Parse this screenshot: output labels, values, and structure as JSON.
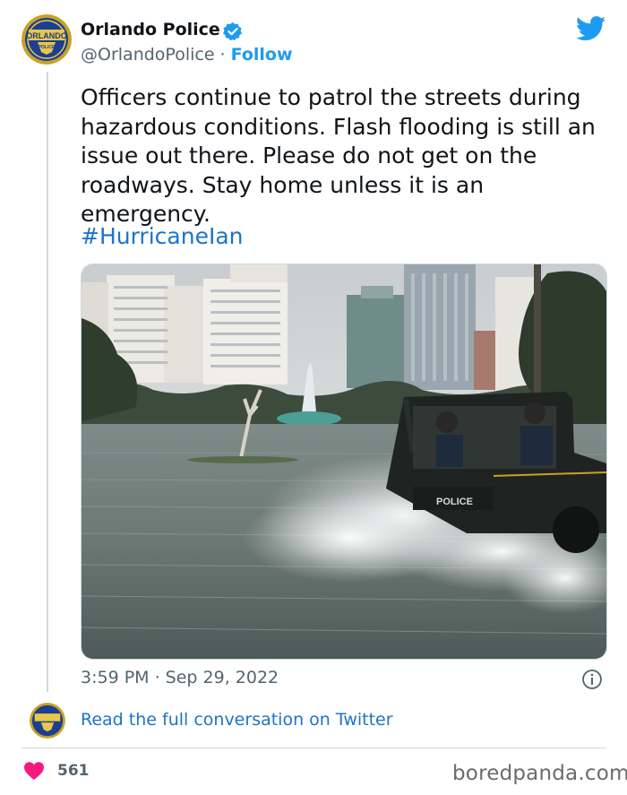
{
  "author": {
    "name": "Orlando Police",
    "handle": "@OrlandoPolice",
    "separator": " · ",
    "follow_label": "Follow",
    "verified": true,
    "avatar_badge_text": "ORLANDO",
    "avatar_badge_subtext": "POLICE"
  },
  "tweet": {
    "text": "Officers continue to patrol the streets during hazardous conditions. Flash flooding is still an issue out there. Please do not get on the roadways. Stay home unless it is an emergency.",
    "hashtag": "#HurricaneIan",
    "media_vehicle_label": "POLICE",
    "timestamp": "3:59 PM · Sep 29, 2022"
  },
  "footer": {
    "read_full": "Read the full conversation on Twitter",
    "likes": "561",
    "watermark": "boredpanda.com"
  },
  "colors": {
    "twitter_blue": "#1d9bf0",
    "link_blue": "#1d74c8",
    "heart_red": "#f91880",
    "text": "#0f1419",
    "muted": "#536471"
  },
  "icons": [
    "verified-badge-icon",
    "twitter-bird-icon",
    "info-icon",
    "heart-icon"
  ]
}
